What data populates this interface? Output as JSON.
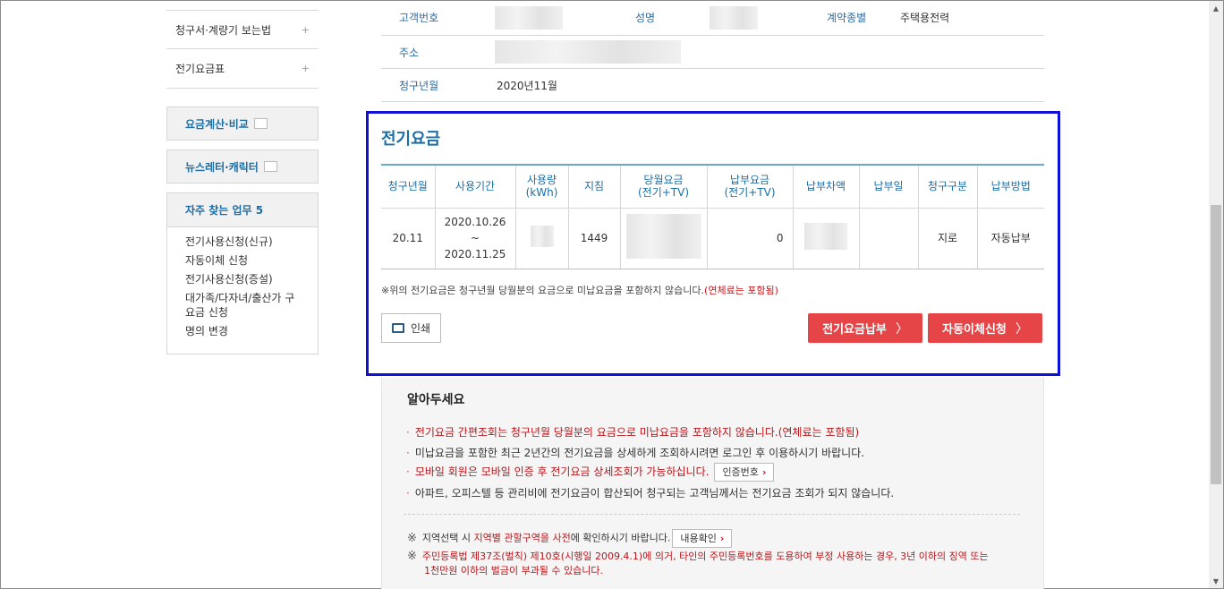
{
  "sidebar": {
    "links": [
      {
        "label": "청구서·계량기 보는법",
        "icon": "+"
      },
      {
        "label": "전기요금표",
        "icon": "+"
      }
    ],
    "boxes": [
      {
        "label": "요금계산·비교"
      },
      {
        "label": "뉴스레터·캐릭터"
      }
    ],
    "faq": {
      "title": "자주 찾는 업무 5",
      "items": [
        "전기사용신청(신규)",
        "자동이체 신청",
        "전기사용신청(증설)",
        "대가족/다자녀/출산가 구 요금 신청",
        "명의 변경"
      ]
    }
  },
  "info": {
    "customer_no_label": "고객번호",
    "name_label": "성명",
    "contract_label": "계약종별",
    "contract_value": "주택용전력",
    "address_label": "주소",
    "bill_month_label": "청구년월",
    "bill_month_value": "2020년11월"
  },
  "bill": {
    "title": "전기요금",
    "headers": [
      "청구년월",
      "사용기간",
      "사용량\n(kWh)",
      "지침",
      "당월요금\n(전기+TV)",
      "납부요금\n(전기+TV)",
      "납부차액",
      "납부일",
      "청구구분",
      "납부방법"
    ],
    "row": {
      "month": "20.11",
      "period_start": "2020.10.26",
      "period_tilde": "~",
      "period_end": "2020.11.25",
      "reading": "1449",
      "paid": "0",
      "billing_type": "지로",
      "payment_method": "자동납부"
    },
    "note": "※위의 전기요금은 청구년월 당월분의 요금으로 미납요금을 포함하지 않습니다.",
    "note_red": "(연체료는 포함됨)",
    "print_label": "인쇄",
    "pay_button": "전기요금납부",
    "autopay_button": "자동이체신청",
    "chevron": "〉"
  },
  "notice": {
    "title": "알아두세요",
    "bullets": [
      "전기요금 간편조회는 청구년월 당월분의 요금으로 미납요금을 포함하지 않습니다.(연체료는 포함됨)",
      "미납요금을 포함한 최근 2년간의 전기요금을 상세하게 조회하시려면 로그인 후 이용하시기 바랍니다.",
      "모바일 회원은 모바일 인증 후 전기요금 상세조회가 가능하십니다.",
      "아파트, 오피스텔 등 관리비에 전기요금이 합산되어 청구되는 고객님께서는 전기요금 조회가 되지 않습니다."
    ],
    "auth_button": "인증번호",
    "region_pre": "지역선택 시 ",
    "region_red": "지역별 관할구역을 사전",
    "region_post": "에 확인하시기 바랍니다.",
    "region_button": "내용확인",
    "law_line1": "주민등록법 제37조(벌칙) 제10호(시행일 2009.4.1)에 의거, 타인의 주민등록번호를 도용하여 부정 사용하는 경우, 3년 이하의 징역 또는",
    "law_line2": "1천만원 이하의 벌금이 부과될 수 있습니다.",
    "mark": "※",
    "arrow": "›"
  }
}
